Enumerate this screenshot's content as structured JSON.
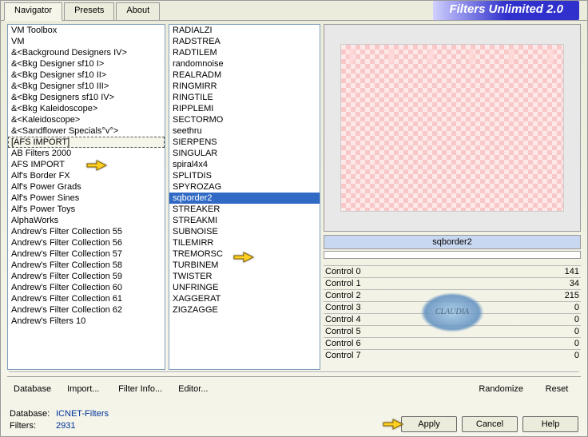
{
  "brand": "Filters Unlimited 2.0",
  "tabs": [
    "Navigator",
    "Presets",
    "About"
  ],
  "categories": [
    "VM Toolbox",
    "VM",
    "&<Background Designers IV>",
    "&<Bkg Designer sf10 I>",
    "&<Bkg Designer sf10 II>",
    "&<Bkg Designer sf10 III>",
    "&<Bkg Designers sf10 IV>",
    "&<Bkg Kaleidoscope>",
    "&<Kaleidoscope>",
    "&<Sandflower Specials°v°>",
    "[AFS IMPORT]",
    "AB Filters 2000",
    "AFS IMPORT",
    "Alf's Border FX",
    "Alf's Power Grads",
    "Alf's Power Sines",
    "Alf's Power Toys",
    "AlphaWorks",
    "Andrew's Filter Collection 55",
    "Andrew's Filter Collection 56",
    "Andrew's Filter Collection 57",
    "Andrew's Filter Collection 58",
    "Andrew's Filter Collection 59",
    "Andrew's Filter Collection 60",
    "Andrew's Filter Collection 61",
    "Andrew's Filter Collection 62",
    "Andrew's Filters 10"
  ],
  "selected_category_index": 10,
  "filters": [
    "RADIALZI",
    "RADSTREA",
    "RADTILEM",
    "randomnoise",
    "REALRADM",
    "RINGMIRR",
    "RINGTILE",
    "RIPPLEMI",
    "SECTORMO",
    "seethru",
    "SIERPENS",
    "SINGULAR",
    "spiral4x4",
    "SPLITDIS",
    "SPYROZAG",
    "sqborder2",
    "STREAKER",
    "STREAKMI",
    "SUBNOISE",
    "TILEMIRR",
    "TREMORSC",
    "TURBINEM",
    "TWISTER",
    "UNFRINGE",
    "XAGGERAT",
    "ZIGZAGGE"
  ],
  "selected_filter_index": 15,
  "current_filter_label": "sqborder2",
  "controls": [
    {
      "label": "Control 0",
      "value": 141
    },
    {
      "label": "Control 1",
      "value": 34
    },
    {
      "label": "Control 2",
      "value": 215
    },
    {
      "label": "Control 3",
      "value": 0
    },
    {
      "label": "Control 4",
      "value": 0
    },
    {
      "label": "Control 5",
      "value": 0
    },
    {
      "label": "Control 6",
      "value": 0
    },
    {
      "label": "Control 7",
      "value": 0
    }
  ],
  "buttons": {
    "database": "Database",
    "import": "Import...",
    "filter_info": "Filter Info...",
    "editor": "Editor...",
    "randomize": "Randomize",
    "reset": "Reset",
    "apply": "Apply",
    "cancel": "Cancel",
    "help": "Help"
  },
  "footer": {
    "database_label": "Database:",
    "database_value": "ICNET-Filters",
    "filters_label": "Filters:",
    "filters_value": "2931"
  },
  "watermark": "CLAUDIA"
}
